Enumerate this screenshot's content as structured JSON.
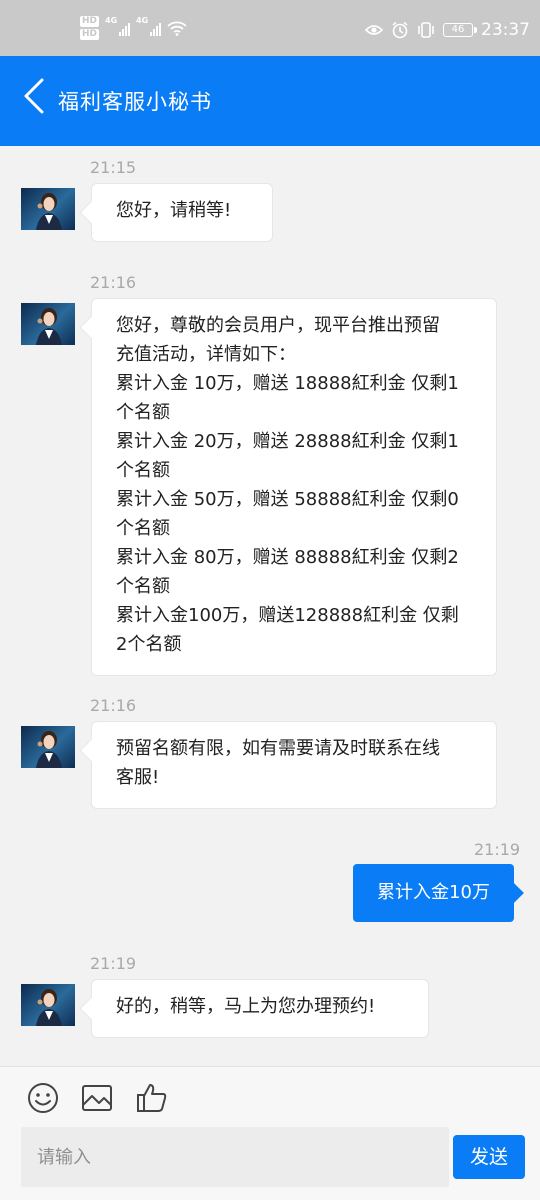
{
  "status_bar": {
    "hd_1": "HD",
    "hd_2": "HD",
    "signal_1": "4G",
    "signal_2": "4G",
    "battery": "46",
    "time": "23:37"
  },
  "header": {
    "title": "福利客服小秘书"
  },
  "messages": [
    {
      "time": "21:15",
      "lines": [
        "您好，请稍等!"
      ]
    },
    {
      "time": "21:16",
      "lines": [
        "您好，尊敬的会员用户，现平台推出预留",
        "充值活动，详情如下：",
        "累计入金 10万，赠送 18888紅利金 仅剩1",
        "个名额",
        "累计入金 20万，赠送 28888紅利金 仅剩1",
        "个名额",
        "累计入金 50万，赠送 58888紅利金 仅剩0",
        "个名额",
        "累计入金 80万，赠送 88888紅利金 仅剩2",
        "个名额",
        "累计入金100万，赠送128888紅利金 仅剩",
        "2个名额"
      ]
    },
    {
      "time": "21:16",
      "lines": [
        "预留名额有限，如有需要请及时联系在线",
        "客服!"
      ]
    },
    {
      "time": "21:19",
      "text": "累计入金10万",
      "from_me": true
    },
    {
      "time": "21:19",
      "lines": [
        "好的，稍等，马上为您办理预约!"
      ]
    }
  ],
  "input": {
    "placeholder": "请输入"
  },
  "send_label": "发送",
  "icons": {
    "emoji": "smile-icon",
    "image": "image-icon",
    "like": "thumbs-up-icon"
  },
  "colors": {
    "brand": "#0a7cf5",
    "status_bar": "#c9c9c9",
    "background": "#f2f2f2"
  }
}
